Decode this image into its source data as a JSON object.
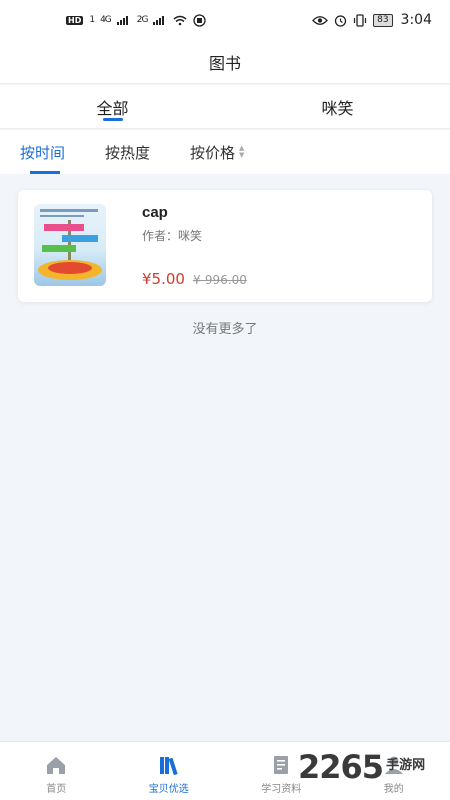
{
  "status_bar": {
    "hd_label": "HD",
    "sim1_label": "1",
    "net1": "4G",
    "net2": "2G",
    "battery": "83",
    "time": "3:04"
  },
  "header": {
    "title": "图书"
  },
  "category_tabs": [
    {
      "label": "全部",
      "active": true
    },
    {
      "label": "咪笑",
      "active": false
    }
  ],
  "sort_bar": {
    "items": [
      {
        "label": "按时间",
        "active": true
      },
      {
        "label": "按热度",
        "active": false
      },
      {
        "label": "按价格",
        "active": false
      }
    ]
  },
  "books": [
    {
      "title": "cap",
      "author": "作者：咪笑",
      "price": "¥5.00",
      "original_price": "¥-996.00"
    }
  ],
  "list_footer": "没有更多了",
  "bottom_nav": [
    {
      "label": "首页",
      "icon": "home-icon",
      "active": false
    },
    {
      "label": "宝贝优选",
      "icon": "books-icon",
      "active": true
    },
    {
      "label": "学习资料",
      "icon": "document-icon",
      "active": false
    },
    {
      "label": "我的",
      "icon": "user-icon",
      "active": false
    }
  ],
  "watermark": {
    "number": "2265",
    "text": "手游网"
  },
  "colors": {
    "accent": "#1a6ed8",
    "price": "#d23a2a",
    "background": "#f2f5f9"
  }
}
